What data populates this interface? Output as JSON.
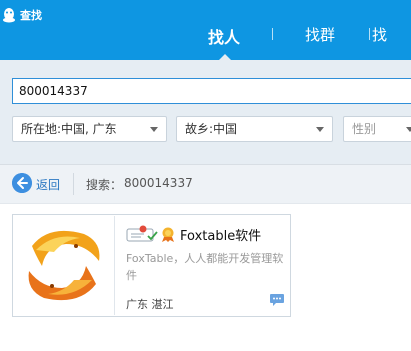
{
  "header": {
    "title": "查找",
    "tabs": [
      {
        "label": "找人",
        "active": true
      },
      {
        "label": "找群",
        "active": false
      },
      {
        "label": "找",
        "active": false
      }
    ]
  },
  "search": {
    "query": "800014337",
    "location_select": "所在地:中国, 广东",
    "hometown_select": "故乡:中国",
    "gender_select": "性别"
  },
  "toolbar": {
    "back_label": "返回",
    "summary_label": "搜索：",
    "summary_value": "800014337"
  },
  "results": [
    {
      "name": "Foxtable软件",
      "description": "FoxTable，人人都能开发管理软件",
      "location": "广东  湛江"
    }
  ],
  "colors": {
    "header": "#0e96e2",
    "search_bg": "#e6edf3",
    "link": "#2b78c2"
  }
}
